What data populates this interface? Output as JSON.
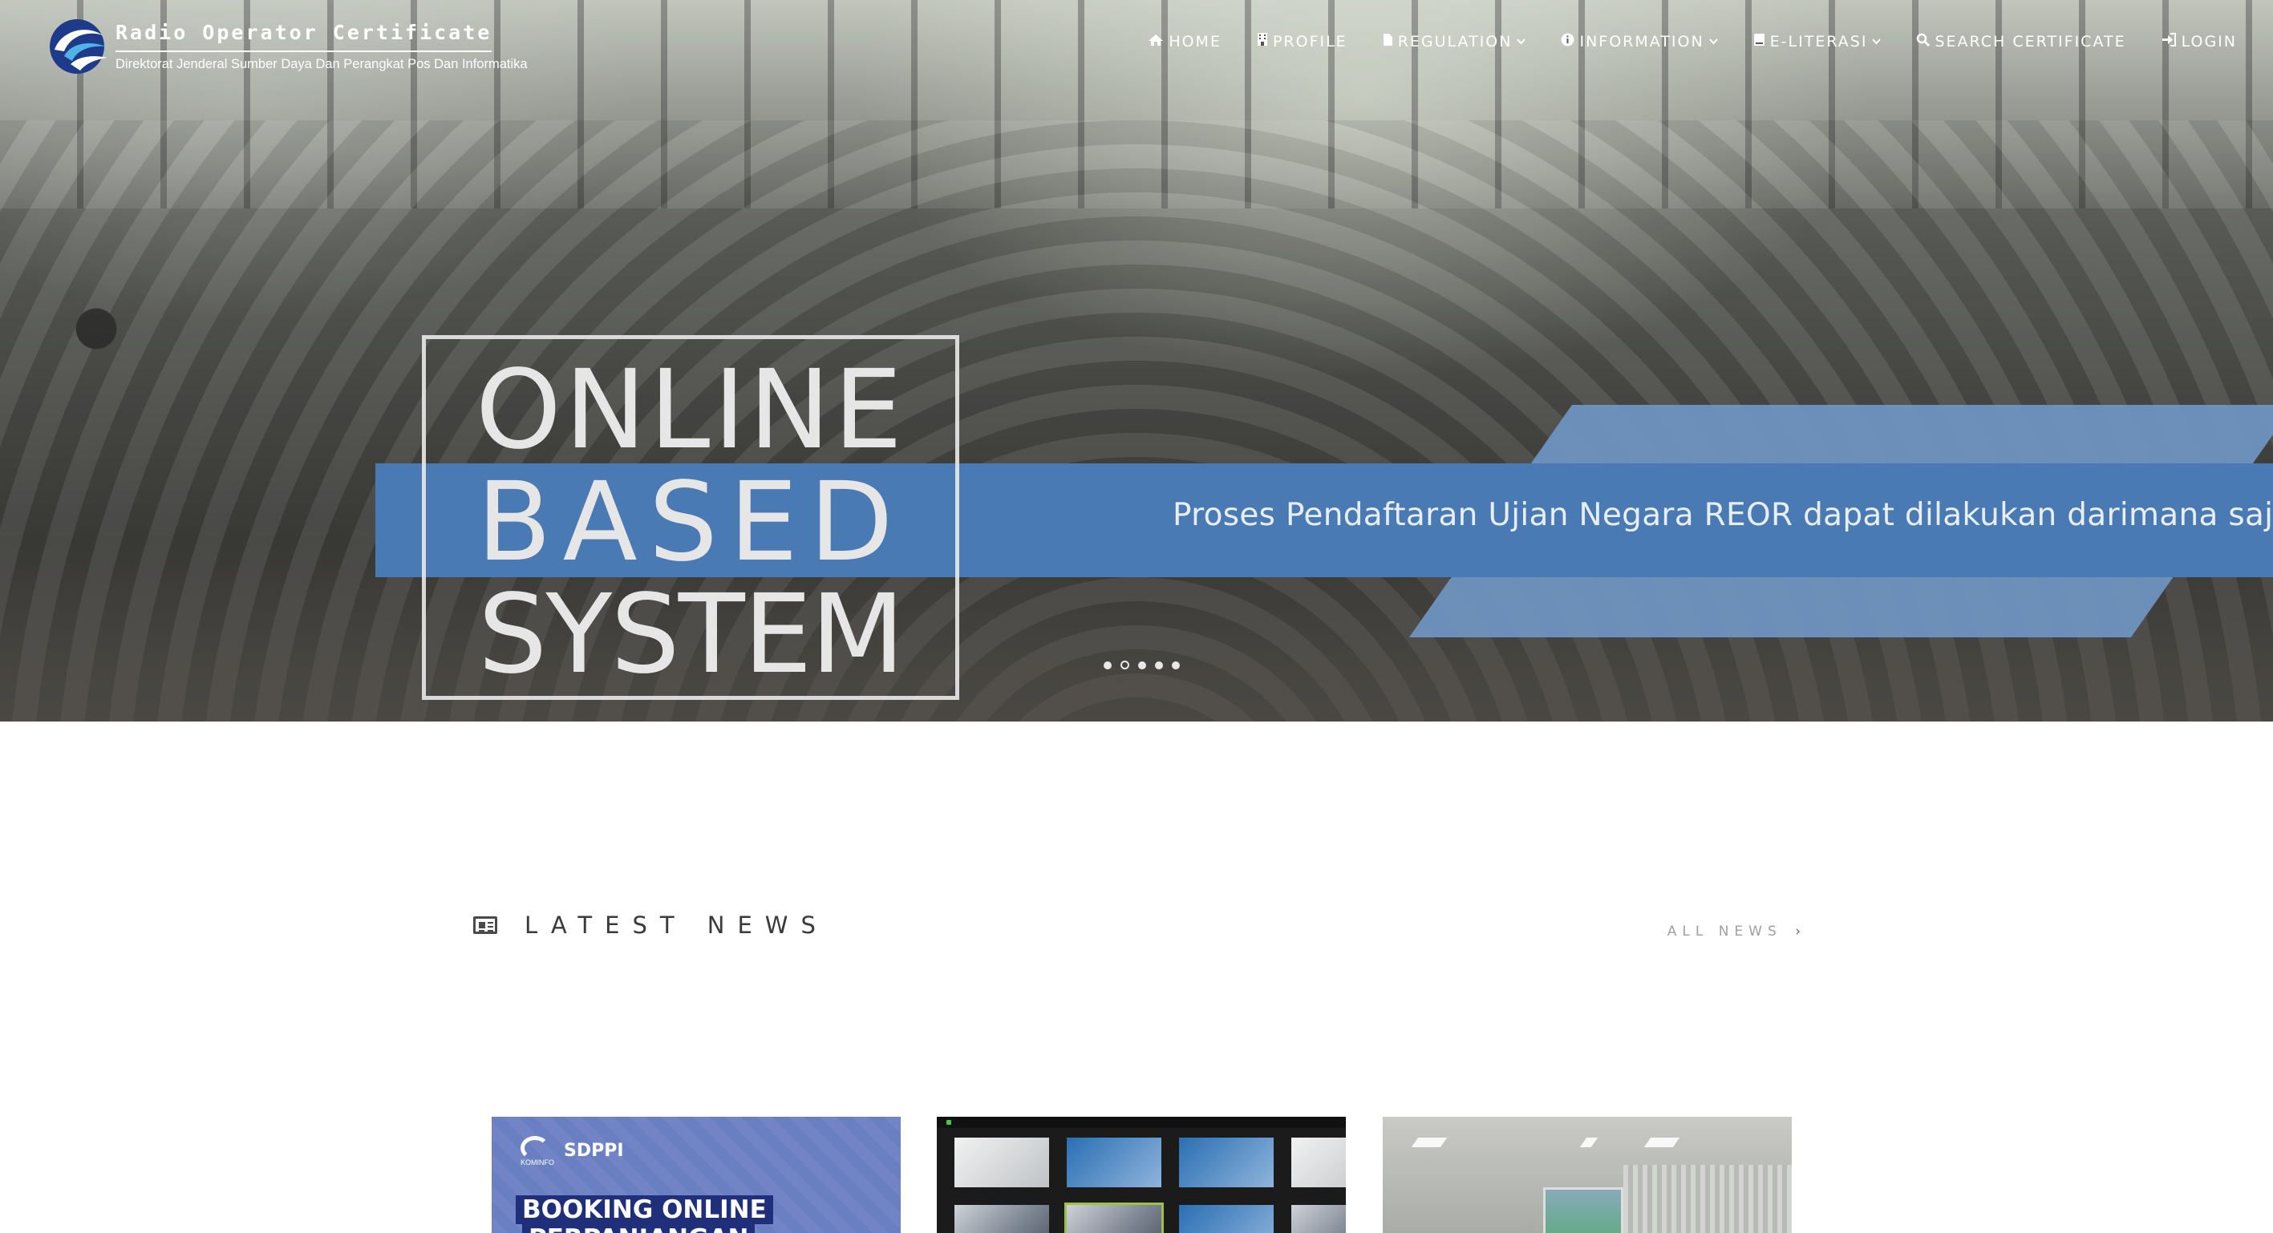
{
  "brand": {
    "title": "Radio Operator Certificate",
    "subtitle": "Direktorat Jenderal Sumber Daya Dan Perangkat Pos Dan Informatika",
    "logo_icon": "kominfo-logo-icon"
  },
  "nav": {
    "items": [
      {
        "label": "HOME",
        "icon": "home-icon",
        "has_dropdown": false
      },
      {
        "label": "PROFILE",
        "icon": "building-icon",
        "has_dropdown": false
      },
      {
        "label": "REGULATION",
        "icon": "file-icon",
        "has_dropdown": true
      },
      {
        "label": "INFORMATION",
        "icon": "info-circle-icon",
        "has_dropdown": true
      },
      {
        "label": "E-LITERASI",
        "icon": "book-icon",
        "has_dropdown": true
      },
      {
        "label": "SEARCH CERTIFICATE",
        "icon": "search-icon",
        "has_dropdown": false
      },
      {
        "label": "LOGIN",
        "icon": "sign-in-icon",
        "has_dropdown": false
      }
    ]
  },
  "hero": {
    "box_line_1": "ONLINE",
    "box_line_2": "BASED",
    "box_line_3": "SYSTEM",
    "banner_text": "Proses Pendaftaran Ujian Negara REOR dapat dilakukan darimana saja",
    "slides_total": 5,
    "slide_active_index": 2,
    "banner_color": "#4a7ab4"
  },
  "news": {
    "title": "LATEST NEWS",
    "all_news_label": "ALL NEWS",
    "cards": [
      {
        "image_logo_text": "KOMINFO",
        "image_brand": "SDPPI",
        "image_heading_1": "BOOKING ONLINE",
        "image_heading_2": "PERPANJANGAN"
      },
      {
        "image_kind": "video-conference-grid"
      },
      {
        "image_kind": "classroom-photo"
      }
    ]
  }
}
